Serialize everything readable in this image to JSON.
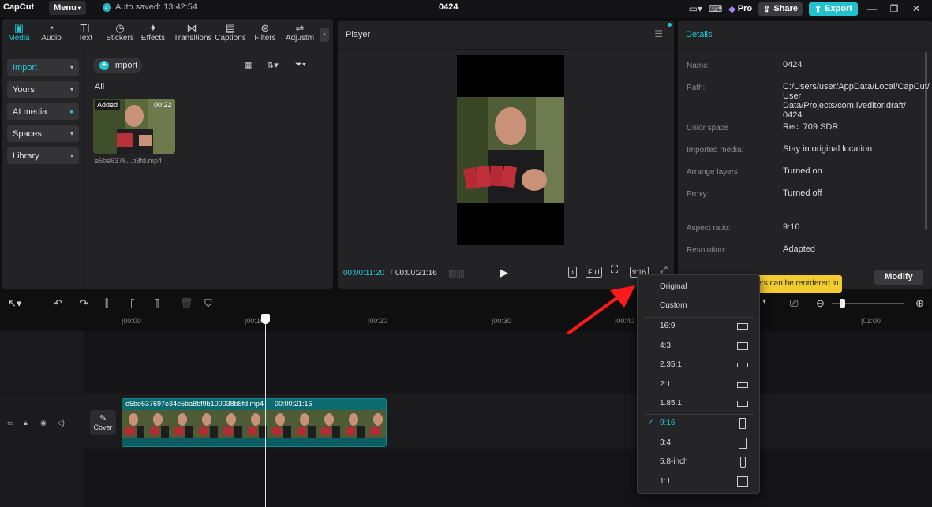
{
  "titlebar": {
    "logo": "CapCut",
    "menu_label": "Menu",
    "autosave": "Auto saved: 13:42:54",
    "project_title": "0424",
    "pro_label": "Pro",
    "share_label": "Share",
    "export_label": "Export"
  },
  "toolbar": {
    "tools": [
      {
        "label": "Media",
        "icon": "media-icon"
      },
      {
        "label": "Audio",
        "icon": "audio-icon"
      },
      {
        "label": "Text",
        "icon": "text-icon"
      },
      {
        "label": "Stickers",
        "icon": "stickers-icon"
      },
      {
        "label": "Effects",
        "icon": "effects-icon"
      },
      {
        "label": "Transitions",
        "icon": "transitions-icon"
      },
      {
        "label": "Captions",
        "icon": "captions-icon"
      },
      {
        "label": "Filters",
        "icon": "filters-icon"
      },
      {
        "label": "Adjustm",
        "icon": "adjustment-icon"
      }
    ]
  },
  "media_sidebar": {
    "items": [
      {
        "label": "Import"
      },
      {
        "label": "Yours"
      },
      {
        "label": "AI media"
      },
      {
        "label": "Spaces"
      },
      {
        "label": "Library"
      }
    ]
  },
  "media": {
    "import_label": "Import",
    "all_label": "All",
    "thumb_badge": "Added",
    "thumb_duration": "00:22",
    "thumb_name": "e5be6376...b8fd.mp4"
  },
  "player": {
    "title": "Player",
    "current_time": "00:00:11:20",
    "separator": "/",
    "total_time": "00:00:21:16",
    "full_label": "Full",
    "ratio_label": "9:16"
  },
  "details": {
    "title": "Details",
    "rows": [
      {
        "label": "Name:",
        "value": "0424"
      },
      {
        "label": "Path:",
        "value": "C:/Users/user/AppData/Local/CapCut/ User Data/Projects/com.lveditor.draft/ 0424"
      },
      {
        "label": "Color space",
        "value": "Rec. 709 SDR"
      },
      {
        "label": "Imported media:",
        "value": "Stay in original location"
      },
      {
        "label": "Arrange layers",
        "value": "Turned on"
      },
      {
        "label": "Proxy:",
        "value": "Turned off"
      },
      {
        "label": "Aspect ratio:",
        "value": "9:16"
      },
      {
        "label": "Resolution:",
        "value": "Adapted"
      }
    ],
    "tip_text": "ers can be reordered in",
    "modify_label": "Modify"
  },
  "timeline": {
    "ticks": [
      "|00:00",
      "|00:10",
      "|00:20",
      "|00:30",
      "|00:40",
      "|01:00"
    ],
    "cover_label": "Cover",
    "clip_name": "e5be637697e34e5ba8bf9b100038b8fd.mp4",
    "clip_duration": "00:00:21:16"
  },
  "ratio_menu": {
    "top_options": [
      "Original",
      "Custom"
    ],
    "options": [
      "16:9",
      "4:3",
      "2.35:1",
      "2:1",
      "1.85:1",
      "9:16",
      "3:4",
      "5.8-inch",
      "1:1"
    ],
    "selected": "9:16"
  },
  "colors": {
    "accent": "#21c6d6",
    "export": "#22c3d1",
    "clip": "#0d6a6f",
    "tip": "#f2cc2e",
    "arrow": "#ff1a1a"
  }
}
